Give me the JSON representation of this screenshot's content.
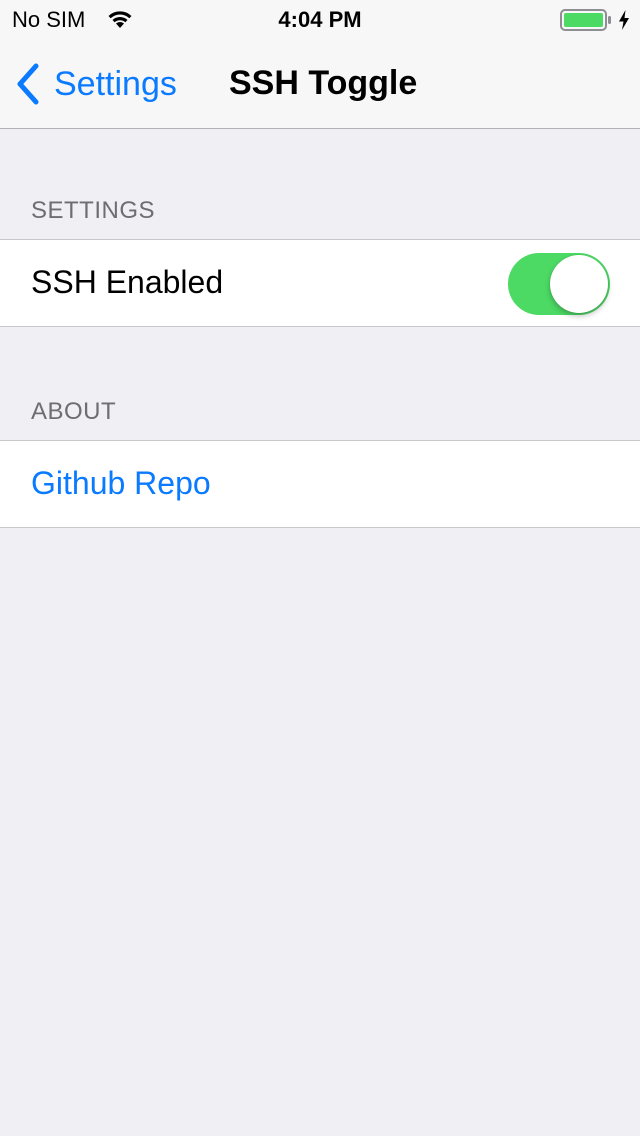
{
  "status_bar": {
    "carrier": "No SIM",
    "time": "4:04 PM",
    "wifi_icon": "wifi-icon",
    "battery_icon": "battery-full-icon",
    "charging_icon": "charging-bolt-icon",
    "battery_color": "#4cd964"
  },
  "nav": {
    "back_label": "Settings",
    "back_icon": "chevron-left-icon",
    "title": "SSH Toggle"
  },
  "sections": {
    "settings": {
      "header": "SETTINGS",
      "ssh_label": "SSH Enabled",
      "ssh_enabled": true
    },
    "about": {
      "header": "ABOUT",
      "github_label": "Github Repo"
    }
  },
  "colors": {
    "accent": "#0a7aff",
    "toggle_on": "#4cd964",
    "background": "#efeff4"
  }
}
